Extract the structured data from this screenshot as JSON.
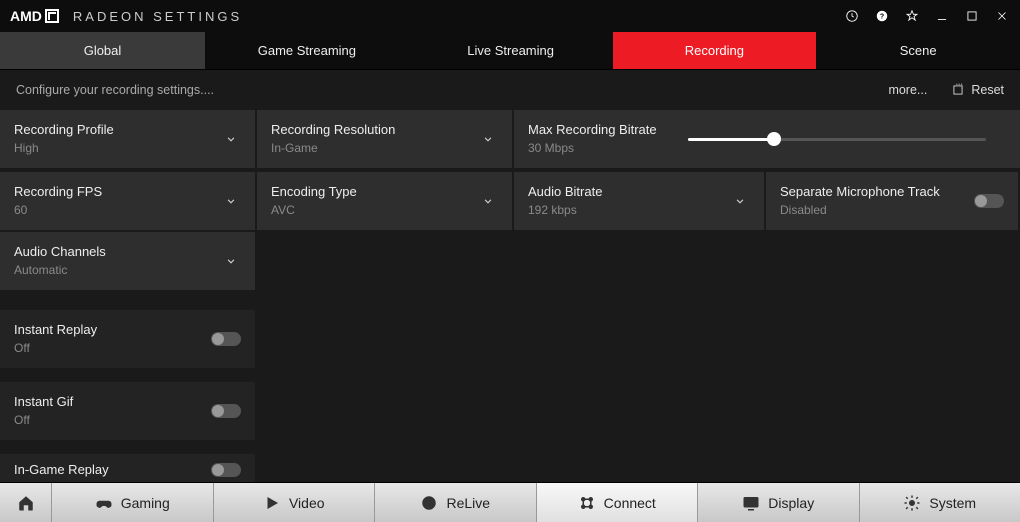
{
  "app": {
    "brand": "AMD",
    "title": "RADEON SETTINGS"
  },
  "top_tabs": {
    "global": "Global",
    "game_streaming": "Game Streaming",
    "live_streaming": "Live Streaming",
    "recording": "Recording",
    "scene": "Scene",
    "active": "recording"
  },
  "subheader": {
    "text": "Configure your recording settings....",
    "more": "more...",
    "reset": "Reset"
  },
  "settings": {
    "recording_profile": {
      "label": "Recording Profile",
      "value": "High"
    },
    "recording_resolution": {
      "label": "Recording Resolution",
      "value": "In-Game"
    },
    "max_bitrate": {
      "label": "Max Recording Bitrate",
      "value": "30 Mbps",
      "percent": 29
    },
    "recording_fps": {
      "label": "Recording FPS",
      "value": "60"
    },
    "encoding_type": {
      "label": "Encoding Type",
      "value": "AVC"
    },
    "audio_bitrate": {
      "label": "Audio Bitrate",
      "value": "192 kbps"
    },
    "separate_mic": {
      "label": "Separate Microphone Track",
      "value": "Disabled",
      "on": false
    },
    "audio_channels": {
      "label": "Audio Channels",
      "value": "Automatic"
    },
    "instant_replay": {
      "label": "Instant Replay",
      "value": "Off",
      "on": false
    },
    "instant_gif": {
      "label": "Instant Gif",
      "value": "Off",
      "on": false
    },
    "ingame_replay": {
      "label": "In-Game Replay",
      "value": "",
      "on": false
    }
  },
  "bottom_nav": {
    "gaming": "Gaming",
    "video": "Video",
    "relive": "ReLive",
    "connect": "Connect",
    "display": "Display",
    "system": "System",
    "active": "connect"
  }
}
